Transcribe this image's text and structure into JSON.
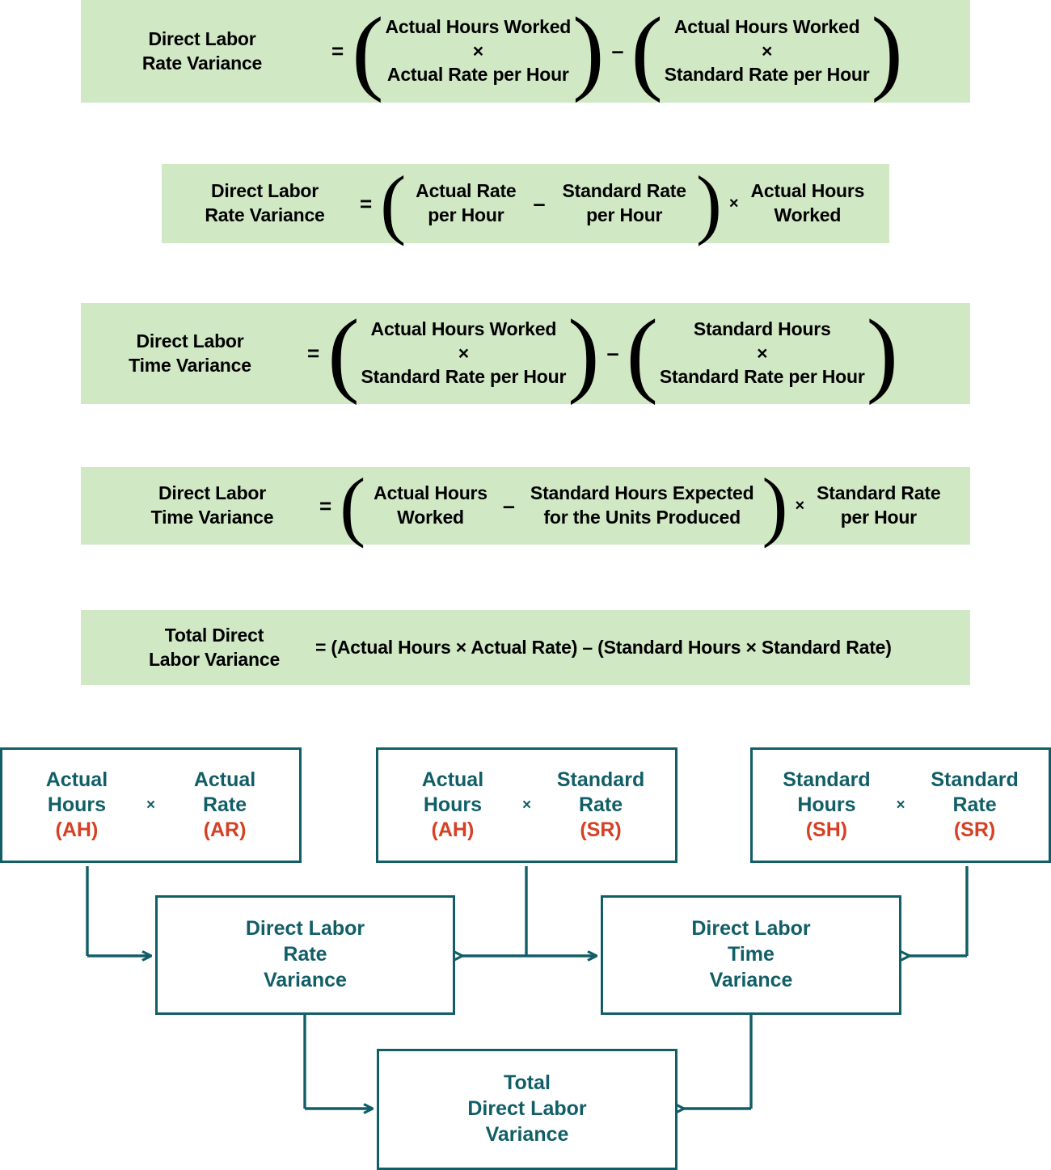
{
  "theme": {
    "band_bg": "#d1e8c5",
    "diagram_stroke": "#115e67",
    "diagram_text": "#115e67",
    "abbr_color": "#d64024",
    "formula_text": "#000000"
  },
  "formulas": [
    {
      "id": "dl-rate-variance-expanded",
      "lhs": "Direct Labor\nRate Variance",
      "equals": "=",
      "group1": "Actual Hours Worked\n×\nActual Rate per Hour",
      "operator": "–",
      "group2": "Actual Hours Worked\n×\nStandard Rate per Hour"
    },
    {
      "id": "dl-rate-variance-factored",
      "lhs": "Direct Labor\nRate Variance",
      "equals": "=",
      "group1": "Actual Rate\nper Hour",
      "operator": "–",
      "group2": "Standard Rate\nper Hour",
      "multiplier_symbol": "×",
      "multiplier": "Actual Hours\nWorked"
    },
    {
      "id": "dl-time-variance-expanded",
      "lhs": "Direct Labor\nTime Variance",
      "equals": "=",
      "group1": "Actual Hours Worked\n×\nStandard Rate per Hour",
      "operator": "–",
      "group2": "Standard Hours\n×\nStandard Rate per Hour"
    },
    {
      "id": "dl-time-variance-factored",
      "lhs": "Direct Labor\nTime Variance",
      "equals": "=",
      "group1": "Actual Hours\nWorked",
      "operator": "–",
      "group2": "Standard Hours Expected\nfor the Units Produced",
      "multiplier_symbol": "×",
      "multiplier": "Standard Rate\nper Hour"
    },
    {
      "id": "total-dl-variance",
      "lhs": "Total Direct\nLabor Variance",
      "expression": "= (Actual Hours × Actual Rate) – (Standard Hours × Standard Rate)"
    }
  ],
  "diagram": {
    "top_boxes": [
      {
        "id": "ah-ar",
        "left_term": "Actual\nHours",
        "left_abbr": "(AH)",
        "operator": "×",
        "right_term": "Actual\nRate",
        "right_abbr": "(AR)"
      },
      {
        "id": "ah-sr",
        "left_term": "Actual\nHours",
        "left_abbr": "(AH)",
        "operator": "×",
        "right_term": "Standard\nRate",
        "right_abbr": "(SR)"
      },
      {
        "id": "sh-sr",
        "left_term": "Standard\nHours",
        "left_abbr": "(SH)",
        "operator": "×",
        "right_term": "Standard\nRate",
        "right_abbr": "(SR)"
      }
    ],
    "variance_boxes": [
      {
        "id": "rate-variance",
        "label": "Direct Labor\nRate\nVariance"
      },
      {
        "id": "time-variance",
        "label": "Direct Labor\nTime\nVariance"
      }
    ],
    "total_box": {
      "id": "total-variance",
      "label": "Total\nDirect Labor\nVariance"
    }
  }
}
